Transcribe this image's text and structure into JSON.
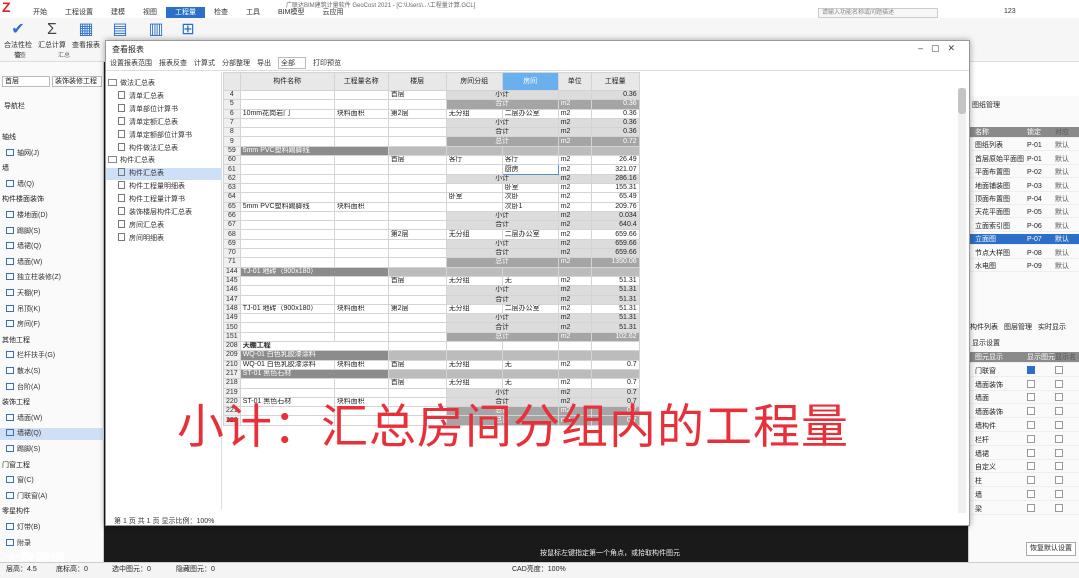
{
  "app": {
    "title": "广联达BIM建筑计量软件 GeoCost 2021 - [C:\\Users\\...\\工程量计算.GCL]"
  },
  "menubar": [
    "开始",
    "工程设置",
    "建模",
    "视图",
    "工程量",
    "检查",
    "工具",
    "BIM模型",
    "云应用"
  ],
  "menu_active": 4,
  "search_placeholder": "请输入功能名称或问题描述",
  "user": "123",
  "ribbon": {
    "buttons": [
      "合法性检查",
      "汇总计算",
      "查看报表"
    ],
    "groups": [
      "检查",
      "汇总"
    ]
  },
  "left": {
    "combo1": "首层",
    "combo2": "装饰装修工程",
    "title": "导航栏",
    "rows": [
      {
        "t": "轴线",
        "sec": true
      },
      {
        "t": "轴网(J)"
      },
      {
        "t": "墙",
        "sec": true
      },
      {
        "t": "墙(Q)"
      },
      {
        "t": "构件楼面装饰",
        "sec": true
      },
      {
        "t": "楼地面(D)"
      },
      {
        "t": "踢脚(S)"
      },
      {
        "t": "墙裙(Q)"
      },
      {
        "t": "墙面(W)"
      },
      {
        "t": "独立柱装修(Z)"
      },
      {
        "t": "天棚(P)"
      },
      {
        "t": "吊顶(K)"
      },
      {
        "t": "房间(F)"
      },
      {
        "t": "其他工程",
        "sec": true
      },
      {
        "t": "栏杆扶手(G)"
      },
      {
        "t": "散水(S)"
      },
      {
        "t": "台阶(A)"
      },
      {
        "t": "装饰工程",
        "sec": true
      },
      {
        "t": "墙面(W)"
      },
      {
        "t": "墙裙(Q)",
        "sel": true
      },
      {
        "t": "踢脚(S)"
      },
      {
        "t": "门窗工程",
        "sec": true
      },
      {
        "t": "窗(C)"
      },
      {
        "t": "门联窗(A)"
      },
      {
        "t": "零星构件",
        "sec": true
      },
      {
        "t": "灯带(B)"
      },
      {
        "t": "附录"
      }
    ]
  },
  "right": {
    "title": "图纸管理",
    "rows_head": [
      "名称",
      "锁定",
      "对应"
    ],
    "rows": [
      {
        "c1": "图纸列表",
        "c2": "P-01",
        "c3": "默认"
      },
      {
        "c1": "首层原始平面图",
        "c2": "P-01",
        "c3": "默认"
      },
      {
        "c1": "平面布置图",
        "c2": "P-02",
        "c3": "默认"
      },
      {
        "c1": "地面铺装图",
        "c2": "P-03",
        "c3": "默认"
      },
      {
        "c1": "顶面布置图",
        "c2": "P-04",
        "c3": "默认"
      },
      {
        "c1": "天花平面图",
        "c2": "P-05",
        "c3": "默认"
      },
      {
        "c1": "立面索引图",
        "c2": "P-06",
        "c3": "默认"
      },
      {
        "c1": "立面图",
        "c2": "P-07",
        "c3": "默认",
        "sel": true
      },
      {
        "c1": "节点大样图",
        "c2": "P-08",
        "c3": "默认"
      },
      {
        "c1": "水电图",
        "c2": "P-09",
        "c3": "默认"
      }
    ],
    "tabs": [
      "构件列表",
      "图层管理",
      "实时显示"
    ],
    "display_title": "显示设置",
    "display_rows": [
      {
        "c1": "图元显示",
        "c2": "显示图元",
        "c3": "显示名"
      },
      {
        "c1": "门联窗",
        "on": true
      },
      {
        "c1": "墙面装饰"
      },
      {
        "c1": "墙面"
      },
      {
        "c1": "墙面装饰"
      },
      {
        "c1": "墙构件"
      },
      {
        "c1": "栏杆"
      },
      {
        "c1": "墙裙"
      },
      {
        "c1": "自定义"
      },
      {
        "c1": "柱"
      },
      {
        "c1": "墙"
      },
      {
        "c1": "梁"
      }
    ],
    "restore": "恢复默认设置"
  },
  "dialog": {
    "title": "查看报表",
    "toolbar": [
      "设置报表范围",
      "报表反查",
      "计算式",
      "分部整理",
      "导出",
      "全部",
      "打印预览"
    ],
    "tree": [
      {
        "t": "做法汇总表",
        "type": "folder"
      },
      {
        "t": "清单汇总表",
        "type": "doc"
      },
      {
        "t": "清单部位计算书",
        "type": "doc"
      },
      {
        "t": "清单定额汇总表",
        "type": "doc"
      },
      {
        "t": "清单定额部位计算书",
        "type": "doc"
      },
      {
        "t": "构件做法汇总表",
        "type": "doc"
      },
      {
        "t": "构件汇总表",
        "type": "folder"
      },
      {
        "t": "构件汇总表",
        "type": "doc",
        "sel": true
      },
      {
        "t": "构件工程量明细表",
        "type": "doc"
      },
      {
        "t": "构件工程量计算书",
        "type": "doc"
      },
      {
        "t": "装饰楼层构件汇总表",
        "type": "doc"
      },
      {
        "t": "房间汇总表",
        "type": "doc"
      },
      {
        "t": "房间明细表",
        "type": "doc"
      }
    ],
    "headers": [
      "",
      "构件名称",
      "工程量名称",
      "楼层",
      "房间分组",
      "房间",
      "单位",
      "工程量"
    ],
    "highlight_col": 5,
    "status": [
      "第",
      "1",
      "页",
      "共",
      "1",
      "页",
      "显示比例：100%"
    ]
  },
  "caption": "小计：汇总房间分组内的工程量",
  "hint": "按鼠标左键指定第一个角点，或拾取构件图元",
  "watermark": "大数跨境",
  "statusbar": [
    "层高：4.5",
    "底标高：0",
    "选中图元：0",
    "隐藏图元：0",
    "CAD亮度：100%"
  ],
  "grid_rows": [
    {
      "rn": "4",
      "floor": "首层",
      "room": "",
      "unit": "",
      "val": "0.36",
      "kind": "sub",
      "label": "小计"
    },
    {
      "rn": "5",
      "kind": "tot",
      "label": "合计",
      "unit": "m2",
      "val": "0.36"
    },
    {
      "rn": "6",
      "comp": "10mm花岗岩门",
      "qty": "块料面积",
      "floor": "第2层",
      "grp": "无分组",
      "room": "二层办公室",
      "unit": "m2",
      "val": "0.36"
    },
    {
      "rn": "7",
      "kind": "sub",
      "label": "小计",
      "unit": "m2",
      "val": "0.36"
    },
    {
      "rn": "8",
      "kind": "sub",
      "label": "合计",
      "unit": "m2",
      "val": "0.36"
    },
    {
      "rn": "9",
      "kind": "tot",
      "label": "总计",
      "unit": "m2",
      "val": "0.72"
    },
    {
      "rn": "59",
      "kind": "grp",
      "label": "5mm PVC塑料踢脚线"
    },
    {
      "rn": "60",
      "floor": "首层",
      "grp": "客厅",
      "room": "客厅",
      "unit": "m2",
      "val": "26.49"
    },
    {
      "rn": "61",
      "room": "厨房",
      "unit": "m2",
      "val": "321.07",
      "edit": true
    },
    {
      "rn": "62",
      "kind": "sub",
      "label": "小计",
      "unit": "m2",
      "val": "286.16"
    },
    {
      "rn": "63",
      "room": "卧室",
      "unit": "m2",
      "val": "155.31"
    },
    {
      "rn": "64",
      "grp": "卧室",
      "room": "次卧",
      "unit": "m2",
      "val": "65.49"
    },
    {
      "rn": "65",
      "comp": "5mm PVC塑料踢脚线",
      "qty": "块料面积",
      "room": "次卧1",
      "unit": "m2",
      "val": "209.76"
    },
    {
      "rn": "66",
      "kind": "sub",
      "label": "小计",
      "unit": "m2",
      "val": "0.034"
    },
    {
      "rn": "67",
      "kind": "sub",
      "label": "合计",
      "unit": "m2",
      "val": "640.4"
    },
    {
      "rn": "68",
      "floor": "第2层",
      "grp": "无分组",
      "room": "二层办公室",
      "unit": "m2",
      "val": "659.66"
    },
    {
      "rn": "69",
      "kind": "sub",
      "label": "小计",
      "unit": "m2",
      "val": "659.66"
    },
    {
      "rn": "70",
      "kind": "sub",
      "label": "合计",
      "unit": "m2",
      "val": "659.66"
    },
    {
      "rn": "71",
      "kind": "tot",
      "label": "总计",
      "unit": "m2",
      "val": "1350.06"
    },
    {
      "rn": "144",
      "kind": "grp",
      "label": "TJ-01 地砖（900x180）"
    },
    {
      "rn": "145",
      "floor": "首层",
      "grp": "无分组",
      "room": "无",
      "unit": "m2",
      "val": "51.31"
    },
    {
      "rn": "146",
      "kind": "sub",
      "label": "小计",
      "unit": "m2",
      "val": "51.31"
    },
    {
      "rn": "147",
      "kind": "sub",
      "label": "合计",
      "unit": "m2",
      "val": "51.31"
    },
    {
      "rn": "148",
      "comp": "TJ-01 地砖（900x180）",
      "qty": "块料面积",
      "floor": "第2层",
      "grp": "无分组",
      "room": "二层办公室",
      "unit": "m2",
      "val": "51.31"
    },
    {
      "rn": "149",
      "kind": "sub",
      "label": "小计",
      "unit": "m2",
      "val": "51.31"
    },
    {
      "rn": "150",
      "kind": "sub",
      "label": "合计",
      "unit": "m2",
      "val": "51.31"
    },
    {
      "rn": "151",
      "kind": "tot",
      "label": "总计",
      "unit": "m2",
      "val": "102.62"
    },
    {
      "rn": "208",
      "kind": "grp",
      "label": "天棚工程",
      "plain": true
    },
    {
      "rn": "209",
      "kind": "grp",
      "label": "WQ-01 白色乳胶漆涂料"
    },
    {
      "rn": "210",
      "comp": "WQ-01 白色乳胶漆涂料",
      "qty": "块料面积",
      "floor": "首层",
      "grp": "无分组",
      "room": "无",
      "unit": "m2",
      "val": "0.7"
    },
    {
      "rn": "217",
      "kind": "grp",
      "label": "ST-01 黑色石材"
    },
    {
      "rn": "218",
      "floor": "首层",
      "grp": "无分组",
      "room": "无",
      "unit": "m2",
      "val": "0.7"
    },
    {
      "rn": "219",
      "kind": "sub",
      "label": "小计",
      "unit": "m2",
      "val": "0.7"
    },
    {
      "rn": "220",
      "comp": "ST-01 黑色石材",
      "qty": "块料面积",
      "kind": "sub",
      "label": "合计",
      "unit": "m2",
      "val": "0.7"
    },
    {
      "rn": "221",
      "kind": "tot",
      "label": "总计",
      "unit": "m2",
      "val": "0.7"
    },
    {
      "rn": "222",
      "kind": "tot",
      "label": "总计",
      "unit": "m2",
      "val": "0.7"
    }
  ]
}
